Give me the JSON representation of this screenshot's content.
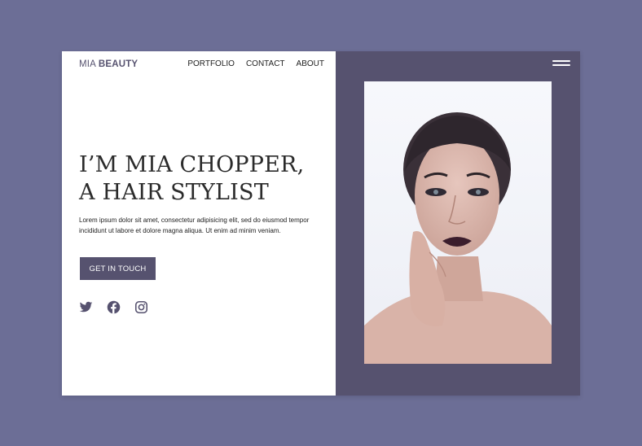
{
  "header": {
    "logo_part1": "MIA ",
    "logo_part2": "BEAUTY",
    "nav": [
      "PORTFOLIO",
      "CONTACT",
      "ABOUT"
    ]
  },
  "hero": {
    "title_line1": "I’M MIA CHOPPER,",
    "title_line2": "A HAIR STYLIST",
    "paragraph": "Lorem ipsum dolor sit amet, consectetur adipisicing elit, sed do eiusmod tempor incididunt ut labore et dolore magna aliqua. Ut enim ad minim veniam.",
    "cta_label": "GET IN TOUCH"
  },
  "social": [
    "twitter-icon",
    "facebook-icon",
    "instagram-icon"
  ],
  "right_panel": {
    "menu_icon": "hamburger-menu-icon",
    "image": "portrait-photo-woman"
  },
  "colors": {
    "page_bg": "#6c6e96",
    "accent": "#56526f",
    "card_bg": "#ffffff",
    "text": "#222222"
  }
}
